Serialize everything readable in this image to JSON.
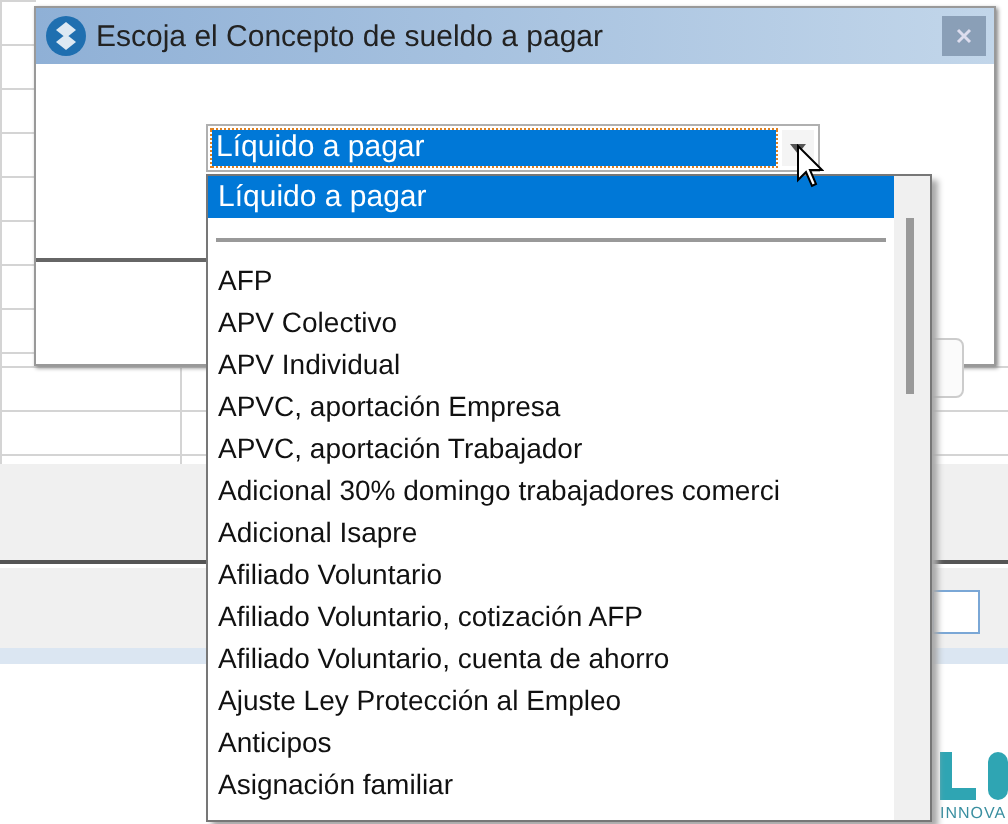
{
  "dialog": {
    "title": "Escoja el Concepto de sueldo a pagar"
  },
  "combo": {
    "value": "Líquido a pagar",
    "focused": true
  },
  "dropdown": {
    "items": [
      {
        "kind": "option",
        "label": "Líquido a pagar",
        "selected": true
      },
      {
        "kind": "separator",
        "selected": false
      },
      {
        "kind": "option",
        "label": "AFP",
        "selected": false
      },
      {
        "kind": "option",
        "label": "APV Colectivo",
        "selected": false
      },
      {
        "kind": "option",
        "label": "APV Individual",
        "selected": false
      },
      {
        "kind": "option",
        "label": "APVC, aportación Empresa",
        "selected": false
      },
      {
        "kind": "option",
        "label": "APVC, aportación Trabajador",
        "selected": false
      },
      {
        "kind": "option",
        "label": "Adicional 30% domingo trabajadores comerci",
        "selected": false
      },
      {
        "kind": "option",
        "label": "Adicional Isapre",
        "selected": false
      },
      {
        "kind": "option",
        "label": "Afiliado Voluntario",
        "selected": false
      },
      {
        "kind": "option",
        "label": "Afiliado Voluntario, cotización AFP",
        "selected": false
      },
      {
        "kind": "option",
        "label": "Afiliado Voluntario, cuenta de ahorro",
        "selected": false
      },
      {
        "kind": "option",
        "label": "Ajuste Ley Protección al Empleo",
        "selected": false
      },
      {
        "kind": "option",
        "label": "Anticipos",
        "selected": false
      },
      {
        "kind": "option",
        "label": "Asignación familiar",
        "selected": false
      }
    ]
  },
  "logo": {
    "caption": "INNOVA"
  }
}
